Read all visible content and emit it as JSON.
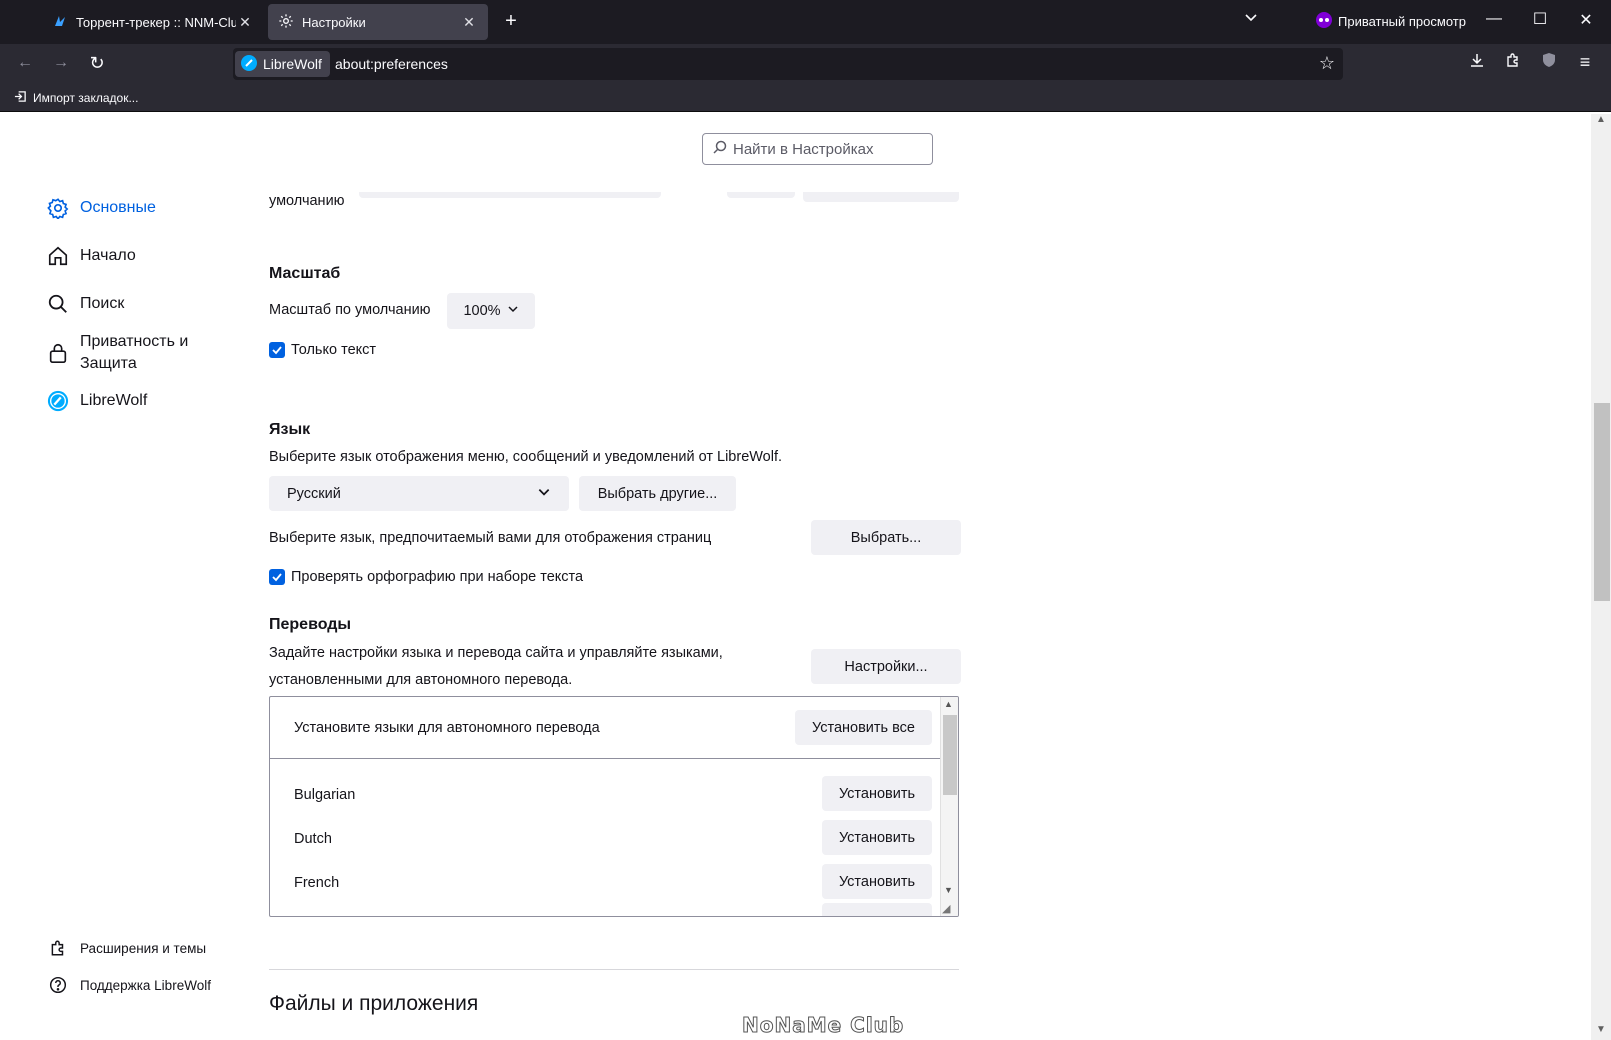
{
  "tabs": [
    {
      "title": "Торрент-трекер :: NNM-Club",
      "active": false
    },
    {
      "title": "Настройки",
      "active": true
    }
  ],
  "private_browsing_label": "Приватный просмотр",
  "identity_label": "LibreWolf",
  "url": "about:preferences",
  "bookmarks": {
    "import_label": "Импорт закладок..."
  },
  "search": {
    "placeholder": "Найти в Настройках"
  },
  "sidebar": {
    "items": [
      {
        "label": "Основные",
        "icon": "gear-icon",
        "selected": true
      },
      {
        "label": "Начало",
        "icon": "home-icon"
      },
      {
        "label": "Поиск",
        "icon": "search-icon"
      },
      {
        "label": "Приватность и Защита",
        "icon": "lock-icon"
      },
      {
        "label": "LibreWolf",
        "icon": "librewolf-icon"
      }
    ],
    "footer": [
      {
        "label": "Расширения и темы",
        "icon": "puzzle-icon"
      },
      {
        "label": "Поддержка LibreWolf",
        "icon": "help-icon"
      }
    ]
  },
  "main": {
    "cut_label": "умолчанию",
    "zoom": {
      "title": "Масштаб",
      "default_label": "Масштаб по умолчанию",
      "default_value": "100%",
      "text_only_label": "Только текст",
      "text_only_checked": true
    },
    "language": {
      "title": "Язык",
      "description": "Выберите язык отображения меню, сообщений и уведомлений от LibreWolf.",
      "selected": "Русский",
      "choose_other_button": "Выбрать другие...",
      "page_lang_label": "Выберите язык, предпочитаемый вами для отображения страниц",
      "choose_button": "Выбрать...",
      "spellcheck_label": "Проверять орфографию при наборе текста",
      "spellcheck_checked": true
    },
    "translations": {
      "title": "Переводы",
      "description_line1": "Задайте настройки языка и перевода сайта и управляйте языками,",
      "description_line2": "установленными для автономного перевода.",
      "settings_button": "Настройки...",
      "list_header": "Установите языки для автономного перевода",
      "install_all_button": "Установить все",
      "install_button": "Установить",
      "languages": [
        "Bulgarian",
        "Dutch",
        "French"
      ]
    },
    "files_apps_title": "Файлы и приложения"
  },
  "watermark": "NoNaMe Club",
  "colors": {
    "accent": "#0061e0",
    "chrome_dark": "#1c1b22",
    "toolbar": "#2b2a33"
  }
}
